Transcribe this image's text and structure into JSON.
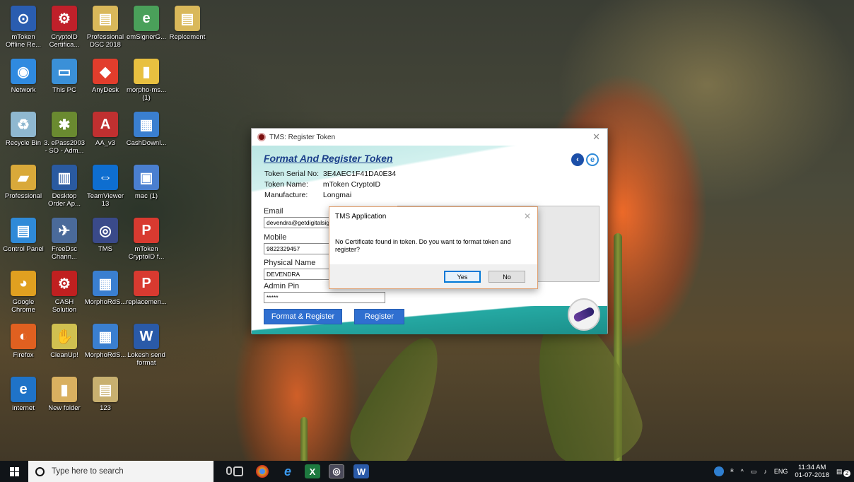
{
  "desktop_icons": [
    {
      "label": "mToken Offline Re...",
      "color": "#2a5db0",
      "glyph": "⊙"
    },
    {
      "label": "CryptoID Certifica...",
      "color": "#c0202a",
      "glyph": "⚙"
    },
    {
      "label": "Professional DSC 2018",
      "color": "#d9b85a",
      "glyph": "▤"
    },
    {
      "label": "emSignerG...",
      "color": "#4aa05a",
      "glyph": "e"
    },
    {
      "label": "Replcement",
      "color": "#d9b85a",
      "glyph": "▤"
    },
    {
      "label": "Network",
      "color": "#2f8ae0",
      "glyph": "◉"
    },
    {
      "label": "This PC",
      "color": "#3a90d8",
      "glyph": "▭"
    },
    {
      "label": "AnyDesk",
      "color": "#e23d2c",
      "glyph": "◆"
    },
    {
      "label": "morpho-ms... (1)",
      "color": "#e8c040",
      "glyph": "▮"
    },
    {
      "label": "Recycle Bin",
      "color": "#8fb8d0",
      "glyph": "♻"
    },
    {
      "label": "3. ePass2003 - SO - Adm...",
      "color": "#6a8a30",
      "glyph": "✱"
    },
    {
      "label": "AA_v3",
      "color": "#c03030",
      "glyph": "A"
    },
    {
      "label": "CashDownl...",
      "color": "#3a7fd0",
      "glyph": "▦"
    },
    {
      "label": "Professional",
      "color": "#d9a93a",
      "glyph": "▰"
    },
    {
      "label": "Desktop Order Ap...",
      "color": "#2a5aa0",
      "glyph": "▥"
    },
    {
      "label": "TeamViewer 13",
      "color": "#0e6ed0",
      "glyph": "⇔"
    },
    {
      "label": "mac (1)",
      "color": "#4a7fd0",
      "glyph": "▣"
    },
    {
      "label": "Control Panel",
      "color": "#2f8ad8",
      "glyph": "▤"
    },
    {
      "label": "FreeDsc Chann...",
      "color": "#4a6a9a",
      "glyph": "✈"
    },
    {
      "label": "TMS",
      "color": "#3a4a8a",
      "glyph": "◎"
    },
    {
      "label": "mToken CryptoID f...",
      "color": "#d83a30",
      "glyph": "P"
    },
    {
      "label": "Google Chrome",
      "color": "#e0a020",
      "glyph": "◕"
    },
    {
      "label": "CASH Solution",
      "color": "#c02020",
      "glyph": "⚙"
    },
    {
      "label": "MorphoRdS...",
      "color": "#3a7fd0",
      "glyph": "▦"
    },
    {
      "label": "replacemen...",
      "color": "#d83a30",
      "glyph": "P"
    },
    {
      "label": "Firefox",
      "color": "#e06020",
      "glyph": "◐"
    },
    {
      "label": "CleanUp!",
      "color": "#d0c050",
      "glyph": "✋"
    },
    {
      "label": "MorphoRdS...",
      "color": "#3a7fd0",
      "glyph": "▦"
    },
    {
      "label": "Lokesh send format",
      "color": "#2a5aa8",
      "glyph": "W"
    },
    {
      "label": "internet",
      "color": "#1f73c8",
      "glyph": "e"
    },
    {
      "label": "New folder",
      "color": "#d9b060",
      "glyph": "▮"
    },
    {
      "label": "123",
      "color": "#c8b070",
      "glyph": "▤"
    }
  ],
  "main_window": {
    "title": "TMS: Register Token",
    "heading": "Format And Register Token",
    "serial_label": "Token Serial No:",
    "serial_value": "3E4AEC1F41DA0E34",
    "name_label": "Token Name:",
    "name_value": "mToken CryptoID",
    "manufacture_label": "Manufacture:",
    "manufacture_value": "Longmai",
    "email_label": "Email",
    "email_value": "devendra@getdigitalsign",
    "mobile_label": "Mobile",
    "mobile_value": "9822329457",
    "physical_name_label": "Physical Name",
    "physical_name_value": "DEVENDRA",
    "admin_pin_label": "Admin Pin",
    "admin_pin_value": "*****",
    "format_register_btn": "Format & Register",
    "register_btn": "Register"
  },
  "dialog": {
    "title": "TMS Application",
    "message": "No Certificate found in token. Do you want to format token and register?",
    "yes": "Yes",
    "no": "No"
  },
  "taskbar": {
    "search_placeholder": "Type here to search",
    "lang": "ENG",
    "time": "11:34 AM",
    "date": "01-07-2018",
    "notification_count": "2"
  }
}
